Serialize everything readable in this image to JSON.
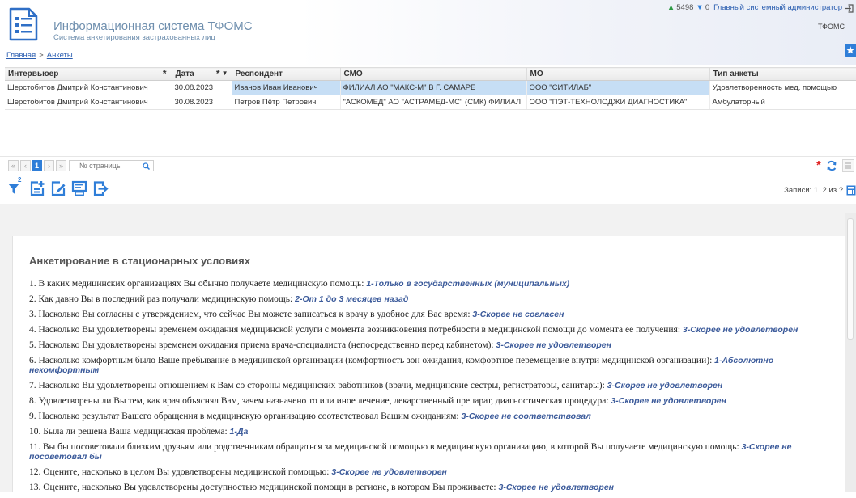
{
  "app": {
    "title": "Информационная система ТФОМС",
    "subtitle": "Система анкетирования застрахованных лиц",
    "logo_icon": "questionnaire-list-icon"
  },
  "user_panel": {
    "up_count": "5498",
    "down_count": "0",
    "user_name": "Главный системный администратор",
    "organization": "ТФОМС",
    "logout_icon": "logout-icon",
    "favorites_icon": "star-icon"
  },
  "breadcrumb": {
    "home": "Главная",
    "separator": ">",
    "current": "Анкеты"
  },
  "grid": {
    "columns": [
      {
        "label": "Интервьюер",
        "required_mark": "*"
      },
      {
        "label": "Дата",
        "required_mark": "*",
        "sort_icon": "▼"
      },
      {
        "label": "Респондент"
      },
      {
        "label": "СМО"
      },
      {
        "label": "МО"
      },
      {
        "label": "Тип анкеты"
      }
    ],
    "rows": [
      {
        "interviewer": "Шерстобитов Дмитрий Константинович",
        "date": "30.08.2023",
        "respondent": "Иванов Иван Иванович",
        "smo": "ФИЛИАЛ АО \"МАКС-М\" В Г. САМАРЕ",
        "mo": "ООО \"СИТИЛАБ\"",
        "type": "Удовлетворенность мед. помощью",
        "selected": true
      },
      {
        "interviewer": "Шерстобитов Дмитрий Константинович",
        "date": "30.08.2023",
        "respondent": "Петров Пётр Петрович",
        "smo": "\"АСКОМЕД\" АО \"АСТРАМЕД-МС\" (СМК) ФИЛИАЛ",
        "mo": "ООО \"ПЭТ-ТЕХНОЛОДЖИ ДИАГНОСТИКА\"",
        "type": "Амбулаторный",
        "selected": false
      }
    ]
  },
  "pager": {
    "first": "«",
    "prev": "‹",
    "current_page": "1",
    "next": "›",
    "last": "»",
    "page_input_placeholder": "№ страницы",
    "required_mark": "*",
    "icons": [
      "search-icon",
      "refresh-icon",
      "menu-icon"
    ]
  },
  "toolbar": {
    "filter_count": "2",
    "records_info": "Записи: 1..2 из ?",
    "icons": [
      "filter-icon",
      "add-icon",
      "edit-icon",
      "view-report-icon",
      "export-icon",
      "calculator-icon"
    ]
  },
  "survey": {
    "title": "Анкетирование в стационарных условиях",
    "items": [
      {
        "num": "1.",
        "question": "В каких медицинских организациях Вы обычно получаете медицинскую помощь:",
        "answer": "1-Только в государственных (муниципальных)"
      },
      {
        "num": "2.",
        "question": "Как давно Вы в последний раз получали медицинскую помощь:",
        "answer": "2-От 1 до 3 месяцев назад"
      },
      {
        "num": "3.",
        "question": "Насколько Вы согласны с утверждением, что сейчас Вы можете записаться к врачу в удобное для Вас время:",
        "answer": "3-Скорее не согласен"
      },
      {
        "num": "4.",
        "question": "Насколько Вы удовлетворены временем ожидания медицинской услуги с момента возникновения потребности в медицинской помощи до момента ее получения:",
        "answer": "3-Скорее не удовлетворен"
      },
      {
        "num": "5.",
        "question": "Насколько Вы удовлетворены временем ожидания приема врача-специалиста (непосредственно перед кабинетом):",
        "answer": "3-Скорее не удовлетворен"
      },
      {
        "num": "6.",
        "question": "Насколько комфортным было Ваше пребывание в медицинской организации (комфортность зон ожидания, комфортное перемещение внутри медицинской организации):",
        "answer": "1-Абсолютно некомфортным"
      },
      {
        "num": "7.",
        "question": "Насколько Вы удовлетворены отношением к Вам со стороны медицинских работников (врачи, медицинские сестры, регистраторы, санитары):",
        "answer": "3-Скорее не удовлетворен"
      },
      {
        "num": "8.",
        "question": "Удовлетворены ли Вы тем, как врач объяснял Вам, зачем назначено то или иное лечение, лекарственный препарат, диагностическая процедура:",
        "answer": "3-Скорее не удовлетворен"
      },
      {
        "num": "9.",
        "question": "Насколько результат Вашего обращения в медицинскую организацию соответствовал Вашим ожиданиям:",
        "answer": "3-Скорее не соответствовал"
      },
      {
        "num": "10.",
        "question": "Была ли решена Ваша медицинская проблема:",
        "answer": "1-Да"
      },
      {
        "num": "11.",
        "question": "Вы бы посоветовали близким друзьям или родственникам обращаться за медицинской помощью в медицинскую организацию, в которой Вы получаете медицинскую помощь:",
        "answer": "3-Скорее не посоветовал бы"
      },
      {
        "num": "12.",
        "question": "Оцените, насколько в целом Вы удовлетворены медицинской помощью:",
        "answer": "3-Скорее не удовлетворен"
      },
      {
        "num": "13.",
        "question": "Оцените, насколько Вы удовлетворены доступностью медицинской помощи в регионе, в котором Вы проживаете:",
        "answer": "3-Скорее не удовлетворен"
      }
    ]
  },
  "colors": {
    "accent": "#2f7ed8",
    "title_text": "#6f8fae",
    "answer_text": "#3b5a9a",
    "selected_row": "#c6def5",
    "required_mark": "#e02424",
    "up_arrow": "#2e9a44"
  }
}
